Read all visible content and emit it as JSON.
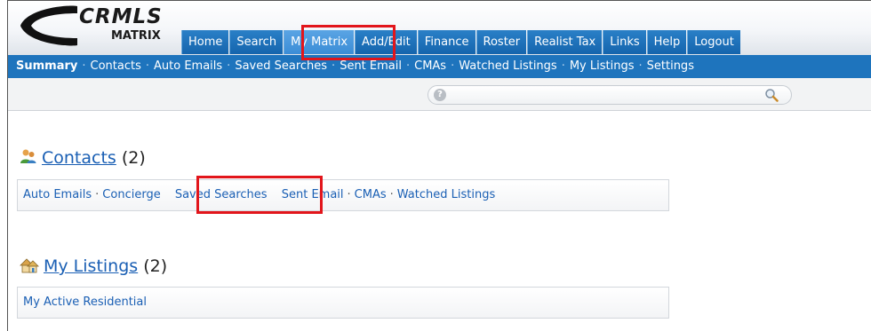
{
  "logo": {
    "text": "CRMLS",
    "subtext": "MATRIX"
  },
  "tabs": [
    {
      "label": "Home"
    },
    {
      "label": "Search"
    },
    {
      "label": "My Matrix"
    },
    {
      "label": "Add/Edit"
    },
    {
      "label": "Finance"
    },
    {
      "label": "Roster"
    },
    {
      "label": "Realist Tax"
    },
    {
      "label": "Links"
    },
    {
      "label": "Help"
    },
    {
      "label": "Logout"
    }
  ],
  "active_tab": "My Matrix",
  "subnav": {
    "items": [
      {
        "label": "Summary"
      },
      {
        "label": "Contacts"
      },
      {
        "label": "Auto Emails"
      },
      {
        "label": "Saved Searches"
      },
      {
        "label": "Sent Email"
      },
      {
        "label": "CMAs"
      },
      {
        "label": "Watched Listings"
      },
      {
        "label": "My Listings"
      },
      {
        "label": "Settings"
      }
    ],
    "separator": "·",
    "active": "Summary"
  },
  "quick_search": {
    "value": "",
    "help_icon": "?"
  },
  "contacts": {
    "title": "Contacts",
    "count": "(2)",
    "links": [
      {
        "label": "Auto Emails"
      },
      {
        "label": "Concierge"
      },
      {
        "label": "Saved Searches"
      },
      {
        "label": "Sent Email"
      },
      {
        "label": "CMAs"
      },
      {
        "label": "Watched Listings"
      }
    ]
  },
  "my_listings": {
    "title": "My Listings",
    "count": "(2)",
    "links": [
      {
        "label": "My Active Residential"
      }
    ]
  },
  "colors": {
    "tab_blue": "#1565ad",
    "tab_active": "#3b8dd6",
    "subnav_blue": "#1e74bd",
    "link_blue": "#1a5fb4",
    "highlight_red": "#e2151b"
  }
}
